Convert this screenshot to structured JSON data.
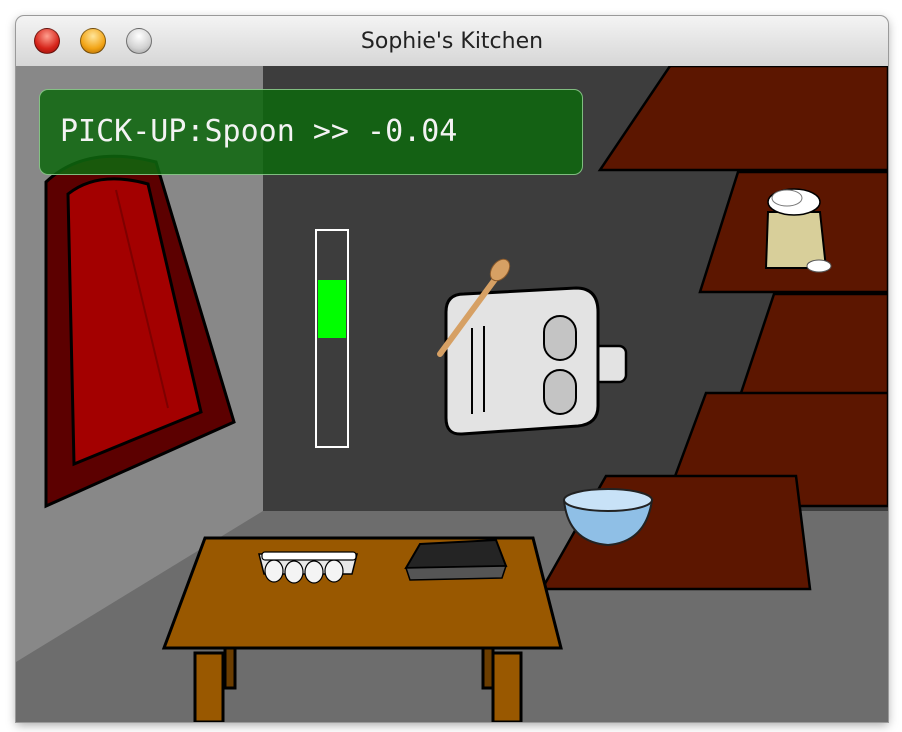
{
  "window": {
    "title": "Sophie's Kitchen"
  },
  "hud": {
    "text": "PICK-UP:Spoon >> -0.04"
  },
  "meter": {
    "level_fraction": 0.27,
    "fill_color": "#00ff00"
  },
  "scene": {
    "colors": {
      "floor": "#6d6d6d",
      "left_wall": "#888888",
      "back_wall": "#3d3d3d",
      "shelf": "#5c1600",
      "table": "#995800",
      "door": "#a30000"
    },
    "objects": [
      "door",
      "shelves",
      "flour-sack",
      "mixing-bowl",
      "table",
      "eggs-carton",
      "baking-tray",
      "robot-sophie",
      "wooden-spoon",
      "reward-meter"
    ]
  }
}
